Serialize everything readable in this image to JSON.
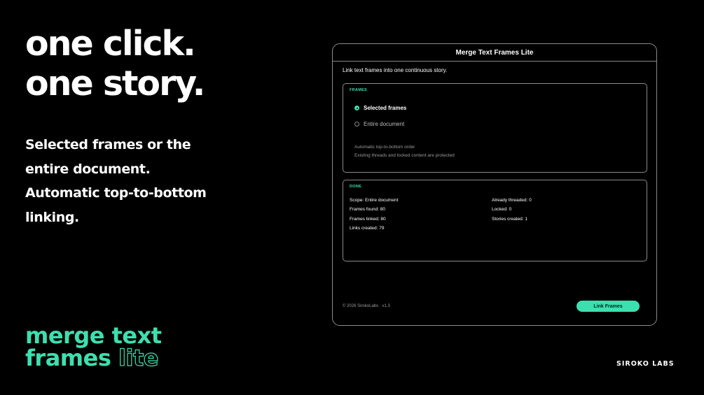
{
  "headline": {
    "line1": "one click.",
    "line2": "one story."
  },
  "description": {
    "lines": [
      "Selected frames or the",
      "entire document.",
      "Automatic top-to-bottom",
      "linking."
    ]
  },
  "brand": {
    "line1": "merge text",
    "line2_solid": "frames",
    "line2_outline": "lite"
  },
  "company": "SIROKO LABS",
  "window": {
    "title": "Merge Text Frames Lite",
    "intro": "Link text frames into one continuous story.",
    "frames_panel": {
      "label": "FRAMES",
      "options": [
        {
          "label": "Selected frames",
          "selected": true
        },
        {
          "label": "Entire document",
          "selected": false
        }
      ],
      "notes": [
        "Automatic top-to-bottom order",
        "Existing threads and locked content are protected"
      ]
    },
    "done_panel": {
      "label": "DONE",
      "left": [
        "Scope: Entire document",
        "Frames found: 80",
        "Frames linked: 80",
        "Links created: 79"
      ],
      "right": [
        "Already threaded: 0",
        "Locked: 0",
        "Stories created: 1"
      ]
    },
    "footer": "© 2026 SirokoLabs · v1.3",
    "button_label": "Link Frames"
  },
  "colors": {
    "accent": "#3ddfae",
    "background": "#000000",
    "border": "#8a8a8a"
  }
}
